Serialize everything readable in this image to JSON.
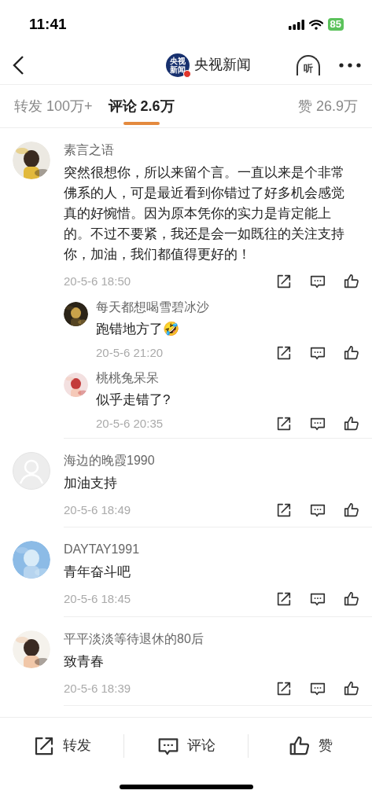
{
  "status_bar": {
    "time": "11:41",
    "battery": "85"
  },
  "header": {
    "logo_text": [
      "央视",
      "新闻"
    ],
    "title": "央视新闻",
    "listen_label": "听"
  },
  "tabs": [
    {
      "label": "转发 100万+",
      "selected": false
    },
    {
      "label": "评论 2.6万",
      "selected": true
    },
    {
      "label": "赞 26.9万",
      "selected": false
    }
  ],
  "comments": [
    {
      "name": "素言之语",
      "avatar": {
        "kind": "picture"
      },
      "text": "突然很想你，所以来留个言。一直以来是个非常佛系的人，可是最近看到你错过了好多机会感觉真的好惋惜。因为原本凭你的实力是肯定能上的。不过不要紧，我还是会一如既往的关注支持你，加油，我们都值得更好的！",
      "time": "20-5-6 18:50",
      "replies": [
        {
          "name": "每天都想喝雪碧冰沙",
          "avatar": {
            "kind": "picture"
          },
          "text": "跑错地方了🤣",
          "time": "20-5-6 21:20"
        },
        {
          "name": "桃桃兔呆呆",
          "avatar": {
            "kind": "picture"
          },
          "text": "似乎走错了?",
          "time": "20-5-6 20:35"
        }
      ]
    },
    {
      "name": "海边的晚霞1990",
      "avatar": {
        "kind": "default"
      },
      "text": "加油支持",
      "time": "20-5-6 18:49"
    },
    {
      "name": "DAYTAY1991",
      "avatar": {
        "kind": "picture"
      },
      "text": "青年奋斗吧",
      "time": "20-5-6 18:45"
    },
    {
      "name": "平平淡淡等待退休的80后",
      "avatar": {
        "kind": "picture"
      },
      "text": "致青春",
      "time": "20-5-6 18:39"
    }
  ],
  "bottom_bar": [
    {
      "kind": "repost",
      "label": "转发"
    },
    {
      "kind": "comment",
      "label": "评论"
    },
    {
      "kind": "like",
      "label": "赞"
    }
  ]
}
